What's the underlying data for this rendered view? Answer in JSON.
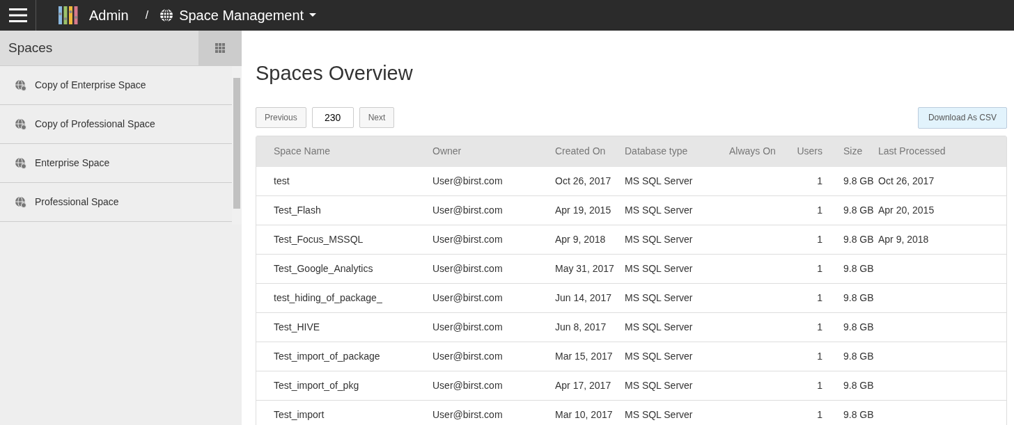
{
  "topbar": {
    "app": "Admin",
    "separator": "/",
    "section": "Space Management"
  },
  "sidebar": {
    "title": "Spaces",
    "items": [
      {
        "label": "Copy of Enterprise Space"
      },
      {
        "label": "Copy of Professional Space"
      },
      {
        "label": "Enterprise Space"
      },
      {
        "label": "Professional Space"
      }
    ]
  },
  "main": {
    "title": "Spaces Overview",
    "pager": {
      "previous": "Previous",
      "page": "230",
      "next": "Next"
    },
    "download": "Download As CSV",
    "table": {
      "columns": [
        "Space Name",
        "Owner",
        "Created On",
        "Database type",
        "Always On",
        "Users",
        "Size",
        "Last Processed"
      ],
      "rows": [
        [
          "test",
          "User@birst.com",
          "Oct 26, 2017",
          "MS SQL Server",
          "",
          "1",
          "9.8 GB",
          "Oct 26, 2017"
        ],
        [
          "Test_Flash",
          "User@birst.com",
          "Apr 19, 2015",
          "MS SQL Server",
          "",
          "1",
          "9.8 GB",
          "Apr 20, 2015"
        ],
        [
          "Test_Focus_MSSQL",
          "User@birst.com",
          "Apr 9, 2018",
          "MS SQL Server",
          "",
          "1",
          "9.8 GB",
          "Apr 9, 2018"
        ],
        [
          "Test_Google_Analytics",
          "User@birst.com",
          "May 31, 2017",
          "MS SQL Server",
          "",
          "1",
          "9.8 GB",
          ""
        ],
        [
          "test_hiding_of_package_",
          "User@birst.com",
          "Jun 14, 2017",
          "MS SQL Server",
          "",
          "1",
          "9.8 GB",
          ""
        ],
        [
          "Test_HIVE",
          "User@birst.com",
          "Jun 8, 2017",
          "MS SQL Server",
          "",
          "1",
          "9.8 GB",
          ""
        ],
        [
          "Test_import_of_package",
          "User@birst.com",
          "Mar 15, 2017",
          "MS SQL Server",
          "",
          "1",
          "9.8 GB",
          ""
        ],
        [
          "Test_import_of_pkg",
          "User@birst.com",
          "Apr 17, 2017",
          "MS SQL Server",
          "",
          "1",
          "9.8 GB",
          ""
        ],
        [
          "Test_import",
          "User@birst.com",
          "Mar 10, 2017",
          "MS SQL Server",
          "",
          "1",
          "9.8 GB",
          ""
        ]
      ]
    }
  }
}
